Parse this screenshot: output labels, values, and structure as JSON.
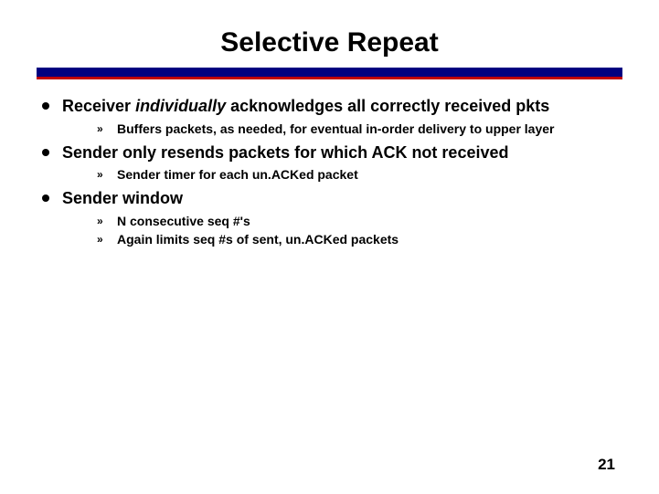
{
  "title": "Selective Repeat",
  "bullets": [
    {
      "prefix": "Receiver ",
      "italic": "individually",
      "suffix": " acknowledges all correctly received pkts",
      "subs": [
        "Buffers packets, as needed, for eventual in-order delivery to upper layer"
      ]
    },
    {
      "prefix": "Sender only resends packets for which ACK not received",
      "italic": "",
      "suffix": "",
      "subs": [
        "Sender timer for each un.ACKed packet"
      ]
    },
    {
      "prefix": "Sender window",
      "italic": "",
      "suffix": "",
      "subs": [
        "N consecutive seq #'s",
        "Again limits seq #s of sent, un.ACKed packets"
      ]
    }
  ],
  "page_number": "21",
  "sub_marker": "»"
}
